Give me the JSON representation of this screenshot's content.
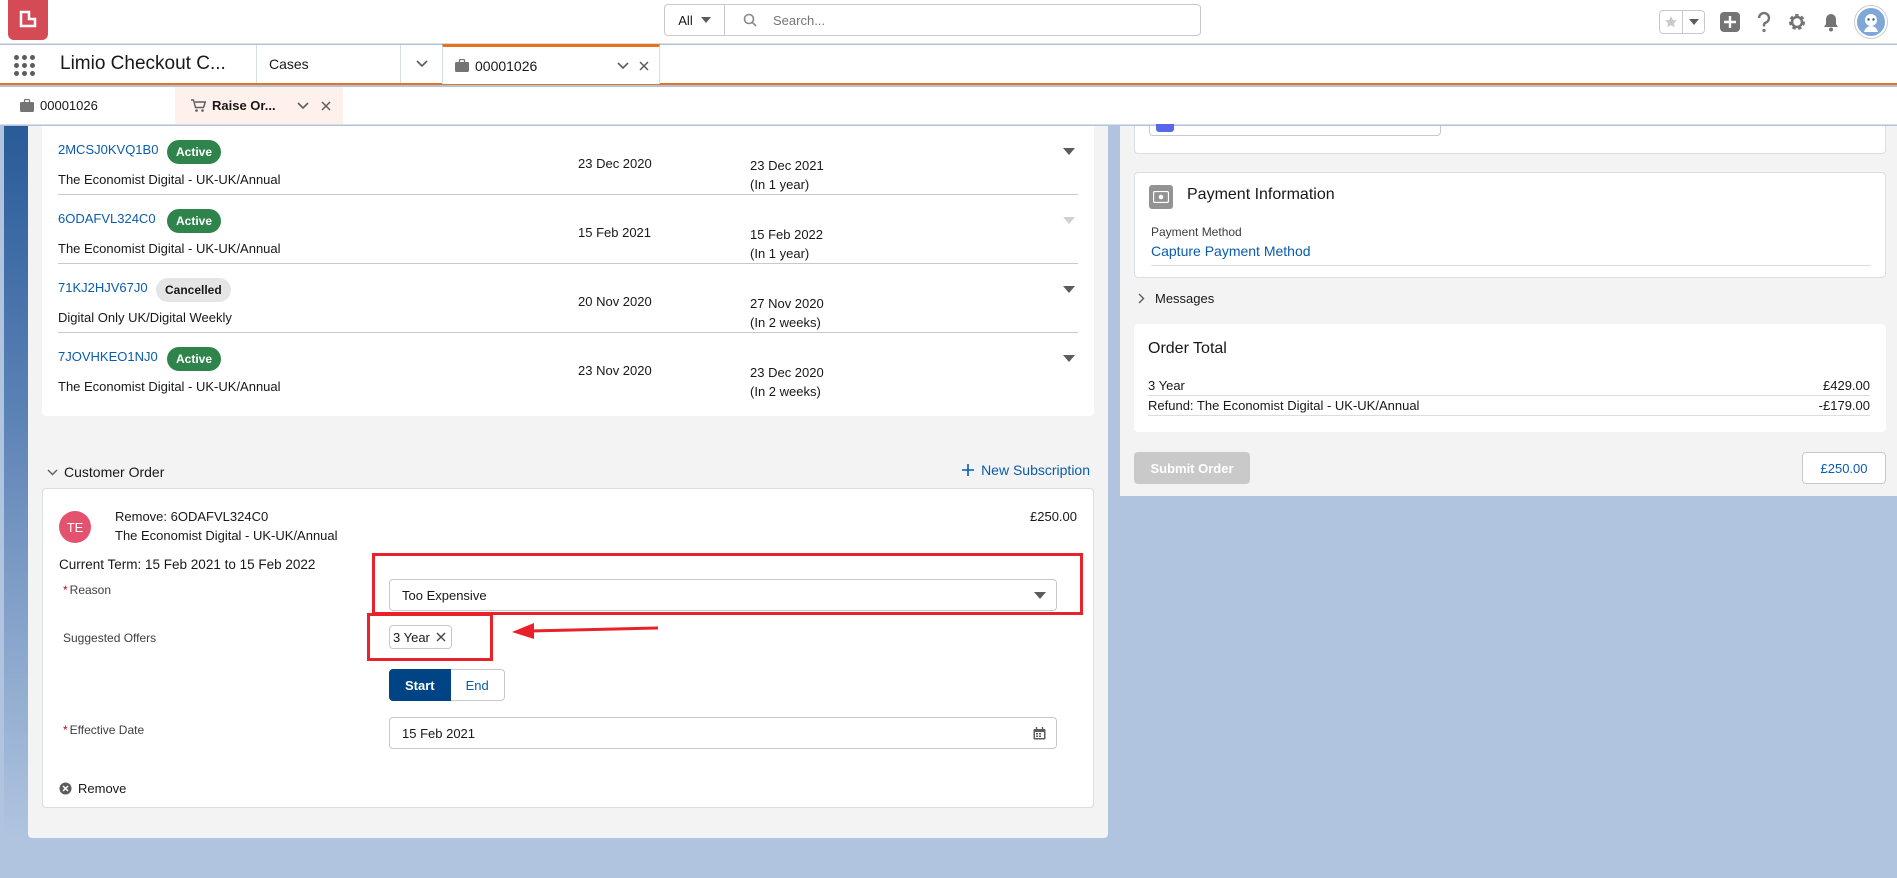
{
  "header": {
    "search_scope": "All",
    "search_placeholder": "Search..."
  },
  "nav": {
    "app_name": "Limio Checkout C...",
    "cases_tab": "Cases",
    "active_tab": "00001026"
  },
  "subtabs": {
    "case_tab": "00001026",
    "order_tab": "Raise Or..."
  },
  "subscriptions": [
    {
      "id": "2MCSJ0KVQ1B0",
      "status": "Active",
      "product": "The Economist Digital - UK-UK/Annual",
      "start": "23 Dec 2020",
      "end": "23 Dec 2021",
      "end_note": "(In 1 year)"
    },
    {
      "id": "6ODAFVL324C0",
      "status": "Active",
      "product": "The Economist Digital - UK-UK/Annual",
      "start": "15 Feb 2021",
      "end": "15 Feb 2022",
      "end_note": "(In 1 year)"
    },
    {
      "id": "71KJ2HJV67J0",
      "status": "Cancelled",
      "product": "Digital Only UK/Digital Weekly",
      "start": "20 Nov 2020",
      "end": "27 Nov 2020",
      "end_note": "(In 2 weeks)"
    },
    {
      "id": "7JOVHKEO1NJ0",
      "status": "Active",
      "product": "The Economist Digital - UK-UK/Annual",
      "start": "23 Nov 2020",
      "end": "23 Dec 2020",
      "end_note": "(In 2 weeks)"
    }
  ],
  "customer_order": {
    "title": "Customer Order",
    "new_subscription": "New Subscription",
    "avatar_initials": "TE",
    "remove_title": "Remove: 6ODAFVL324C0",
    "remove_product": "The Economist Digital - UK-UK/Annual",
    "price": "£250.00",
    "current_term": "Current Term: 15 Feb 2021 to 15 Feb 2022",
    "reason_label": "Reason",
    "reason_value": "Too Expensive",
    "offers_label": "Suggested Offers",
    "offer_pill": "3 Year",
    "start_btn": "Start",
    "end_btn": "End",
    "effective_label": "Effective Date",
    "effective_value": "15 Feb 2021",
    "remove_link": "Remove",
    "required_mark": "*"
  },
  "payment": {
    "title": "Payment Information",
    "method_label": "Payment Method",
    "method_link": "Capture Payment Method"
  },
  "messages": {
    "label": "Messages"
  },
  "order_total": {
    "title": "Order Total",
    "lines": [
      {
        "label": "3 Year",
        "amount": "£429.00"
      },
      {
        "label": "Refund: The Economist Digital - UK-UK/Annual",
        "amount": "-£179.00"
      }
    ],
    "submit": "Submit Order",
    "total": "£250.00"
  },
  "colors": {
    "brand_orange": "#e8731f",
    "link_blue": "#0b5cab",
    "active_badge": "#2e844a",
    "annotation_red": "#e8212a"
  }
}
